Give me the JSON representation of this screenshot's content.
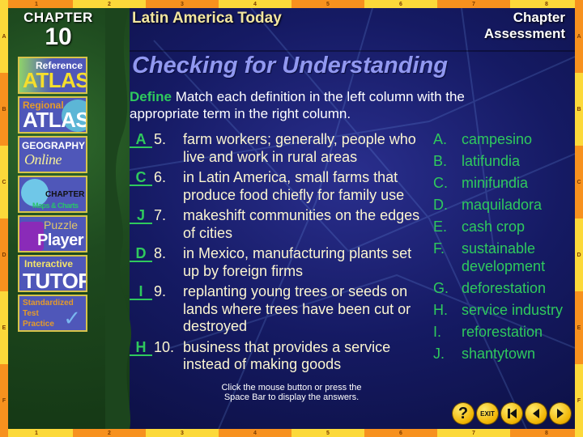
{
  "frame": {
    "columns": [
      "1",
      "2",
      "3",
      "4",
      "5",
      "6",
      "7",
      "8"
    ],
    "rows": [
      "A",
      "B",
      "C",
      "D",
      "E",
      "F"
    ]
  },
  "header": {
    "chapter_label": "CHAPTER",
    "chapter_number": "10",
    "book_title": "Latin America Today",
    "section_title_line1": "Chapter",
    "section_title_line2": "Assessment"
  },
  "sidebar": {
    "items": [
      {
        "line1": "Reference",
        "line2": "ATLAS"
      },
      {
        "line1": "Regional",
        "line2": "ATLAS"
      },
      {
        "line1": "GEOGRAPHY",
        "line2": "Online"
      },
      {
        "line1": "CHAPTER",
        "line2": "Maps & Charts"
      },
      {
        "line1": "Puzzle",
        "line2": "Player"
      },
      {
        "line1": "Interactive",
        "line2": "TUTOR"
      },
      {
        "line1": "Standardized Test Practice",
        "line2": ""
      }
    ]
  },
  "main": {
    "title": "Checking for Understanding",
    "instruction_label": "Define",
    "instruction_text": "  Match each definition in the left column with the appropriate term in the right column.",
    "questions": [
      {
        "answer": "A",
        "number": "5.",
        "text": "farm workers; generally, people who live and work in rural areas"
      },
      {
        "answer": "C",
        "number": "6.",
        "text": "in Latin America, small farms that produce food chiefly for family use"
      },
      {
        "answer": "J",
        "number": "7.",
        "text": "makeshift communities on the edges of cities"
      },
      {
        "answer": "D",
        "number": "8.",
        "text": "in Mexico, manufacturing plants set up by foreign firms"
      },
      {
        "answer": "I",
        "number": "9.",
        "text": "replanting young trees or seeds on lands where trees have been cut or destroyed"
      },
      {
        "answer": "H",
        "number": "10.",
        "text": "business that provides a service instead of making goods"
      }
    ],
    "terms": [
      {
        "letter": "A.",
        "word": "campesino"
      },
      {
        "letter": "B.",
        "word": "latifundia"
      },
      {
        "letter": "C.",
        "word": "minifundia"
      },
      {
        "letter": "D.",
        "word": "maquiladora"
      },
      {
        "letter": "E.",
        "word": "cash crop"
      },
      {
        "letter": "F.",
        "word": "sustainable development"
      },
      {
        "letter": "G.",
        "word": "deforestation"
      },
      {
        "letter": "H.",
        "word": "service industry"
      },
      {
        "letter": "I.",
        "word": "reforestation"
      },
      {
        "letter": "J.",
        "word": "shantytown"
      }
    ],
    "hint_line1": "Click the mouse button or press the",
    "hint_line2": "Space Bar to display the answers."
  },
  "controls": {
    "help": "?",
    "exit": "EXIT"
  },
  "colors": {
    "answer_green": "#2fc95d",
    "title_lavender": "#9198f0",
    "frame_orange": "#f7911e",
    "frame_yellow": "#fcd93a",
    "button_gold": "#f0b300"
  }
}
